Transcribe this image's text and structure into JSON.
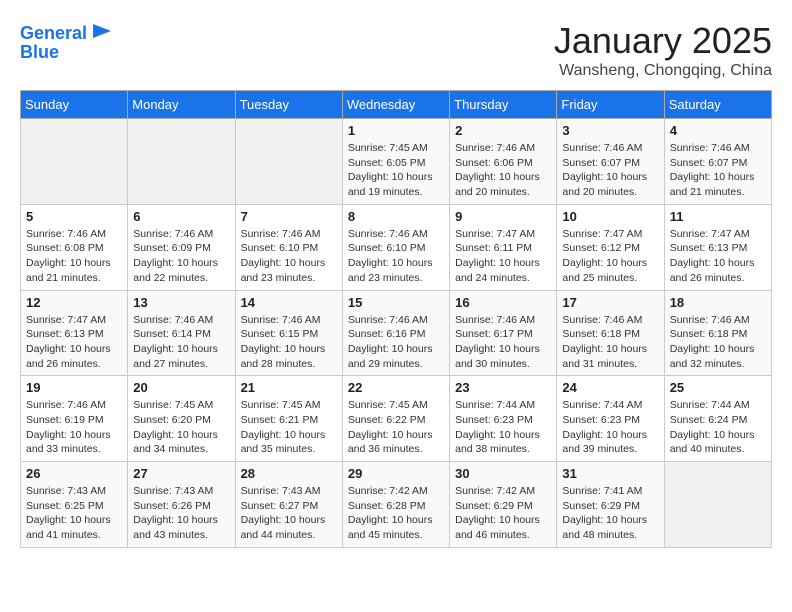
{
  "header": {
    "logo_line1": "General",
    "logo_line2": "Blue",
    "month": "January 2025",
    "location": "Wansheng, Chongqing, China"
  },
  "days_of_week": [
    "Sunday",
    "Monday",
    "Tuesday",
    "Wednesday",
    "Thursday",
    "Friday",
    "Saturday"
  ],
  "weeks": [
    [
      {
        "day": "",
        "info": ""
      },
      {
        "day": "",
        "info": ""
      },
      {
        "day": "",
        "info": ""
      },
      {
        "day": "1",
        "info": "Sunrise: 7:45 AM\nSunset: 6:05 PM\nDaylight: 10 hours and 19 minutes."
      },
      {
        "day": "2",
        "info": "Sunrise: 7:46 AM\nSunset: 6:06 PM\nDaylight: 10 hours and 20 minutes."
      },
      {
        "day": "3",
        "info": "Sunrise: 7:46 AM\nSunset: 6:07 PM\nDaylight: 10 hours and 20 minutes."
      },
      {
        "day": "4",
        "info": "Sunrise: 7:46 AM\nSunset: 6:07 PM\nDaylight: 10 hours and 21 minutes."
      }
    ],
    [
      {
        "day": "5",
        "info": "Sunrise: 7:46 AM\nSunset: 6:08 PM\nDaylight: 10 hours and 21 minutes."
      },
      {
        "day": "6",
        "info": "Sunrise: 7:46 AM\nSunset: 6:09 PM\nDaylight: 10 hours and 22 minutes."
      },
      {
        "day": "7",
        "info": "Sunrise: 7:46 AM\nSunset: 6:10 PM\nDaylight: 10 hours and 23 minutes."
      },
      {
        "day": "8",
        "info": "Sunrise: 7:46 AM\nSunset: 6:10 PM\nDaylight: 10 hours and 23 minutes."
      },
      {
        "day": "9",
        "info": "Sunrise: 7:47 AM\nSunset: 6:11 PM\nDaylight: 10 hours and 24 minutes."
      },
      {
        "day": "10",
        "info": "Sunrise: 7:47 AM\nSunset: 6:12 PM\nDaylight: 10 hours and 25 minutes."
      },
      {
        "day": "11",
        "info": "Sunrise: 7:47 AM\nSunset: 6:13 PM\nDaylight: 10 hours and 26 minutes."
      }
    ],
    [
      {
        "day": "12",
        "info": "Sunrise: 7:47 AM\nSunset: 6:13 PM\nDaylight: 10 hours and 26 minutes."
      },
      {
        "day": "13",
        "info": "Sunrise: 7:46 AM\nSunset: 6:14 PM\nDaylight: 10 hours and 27 minutes."
      },
      {
        "day": "14",
        "info": "Sunrise: 7:46 AM\nSunset: 6:15 PM\nDaylight: 10 hours and 28 minutes."
      },
      {
        "day": "15",
        "info": "Sunrise: 7:46 AM\nSunset: 6:16 PM\nDaylight: 10 hours and 29 minutes."
      },
      {
        "day": "16",
        "info": "Sunrise: 7:46 AM\nSunset: 6:17 PM\nDaylight: 10 hours and 30 minutes."
      },
      {
        "day": "17",
        "info": "Sunrise: 7:46 AM\nSunset: 6:18 PM\nDaylight: 10 hours and 31 minutes."
      },
      {
        "day": "18",
        "info": "Sunrise: 7:46 AM\nSunset: 6:18 PM\nDaylight: 10 hours and 32 minutes."
      }
    ],
    [
      {
        "day": "19",
        "info": "Sunrise: 7:46 AM\nSunset: 6:19 PM\nDaylight: 10 hours and 33 minutes."
      },
      {
        "day": "20",
        "info": "Sunrise: 7:45 AM\nSunset: 6:20 PM\nDaylight: 10 hours and 34 minutes."
      },
      {
        "day": "21",
        "info": "Sunrise: 7:45 AM\nSunset: 6:21 PM\nDaylight: 10 hours and 35 minutes."
      },
      {
        "day": "22",
        "info": "Sunrise: 7:45 AM\nSunset: 6:22 PM\nDaylight: 10 hours and 36 minutes."
      },
      {
        "day": "23",
        "info": "Sunrise: 7:44 AM\nSunset: 6:23 PM\nDaylight: 10 hours and 38 minutes."
      },
      {
        "day": "24",
        "info": "Sunrise: 7:44 AM\nSunset: 6:23 PM\nDaylight: 10 hours and 39 minutes."
      },
      {
        "day": "25",
        "info": "Sunrise: 7:44 AM\nSunset: 6:24 PM\nDaylight: 10 hours and 40 minutes."
      }
    ],
    [
      {
        "day": "26",
        "info": "Sunrise: 7:43 AM\nSunset: 6:25 PM\nDaylight: 10 hours and 41 minutes."
      },
      {
        "day": "27",
        "info": "Sunrise: 7:43 AM\nSunset: 6:26 PM\nDaylight: 10 hours and 43 minutes."
      },
      {
        "day": "28",
        "info": "Sunrise: 7:43 AM\nSunset: 6:27 PM\nDaylight: 10 hours and 44 minutes."
      },
      {
        "day": "29",
        "info": "Sunrise: 7:42 AM\nSunset: 6:28 PM\nDaylight: 10 hours and 45 minutes."
      },
      {
        "day": "30",
        "info": "Sunrise: 7:42 AM\nSunset: 6:29 PM\nDaylight: 10 hours and 46 minutes."
      },
      {
        "day": "31",
        "info": "Sunrise: 7:41 AM\nSunset: 6:29 PM\nDaylight: 10 hours and 48 minutes."
      },
      {
        "day": "",
        "info": ""
      }
    ]
  ]
}
